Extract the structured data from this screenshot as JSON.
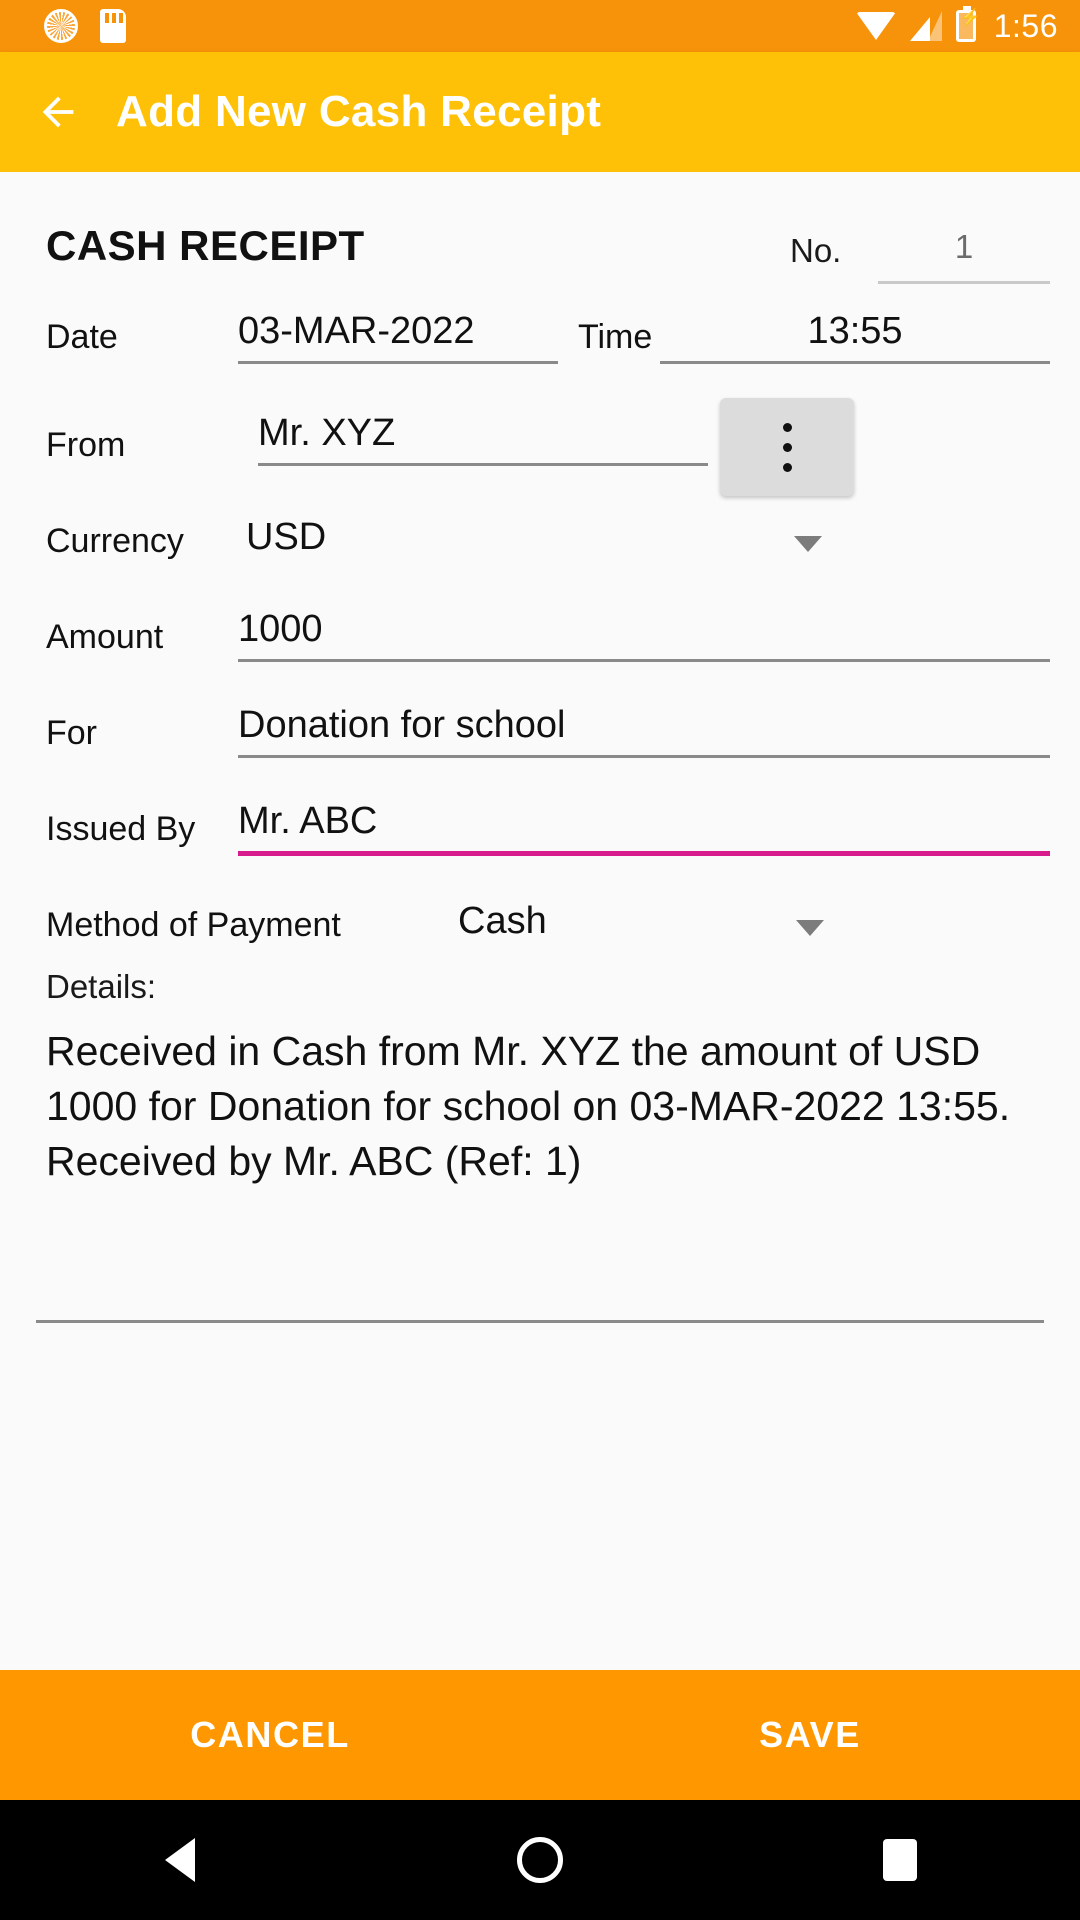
{
  "statusbar": {
    "clock": "1:56",
    "icons": [
      "brightness-icon",
      "sd-card-icon",
      "wifi-icon",
      "signal-icon",
      "battery-charging-icon"
    ]
  },
  "toolbar": {
    "back_label": "back-arrow",
    "title": "Add New Cash Receipt",
    "background": "#FFC107"
  },
  "form": {
    "section_title": "CASH RECEIPT",
    "no_label": "No.",
    "no_value": "1",
    "date_label": "Date",
    "date_value": "03-MAR-2022",
    "time_label": "Time",
    "time_value": "13:55",
    "from_label": "From",
    "from_value": "Mr. XYZ",
    "more_button_label": "⋮",
    "currency_label": "Currency",
    "currency_value": "USD",
    "amount_label": "Amount",
    "amount_value": "1000",
    "for_label": "For",
    "for_value": "Donation for school",
    "issued_by_label": "Issued By",
    "issued_by_value": "Mr. ABC",
    "issued_by_focus_color": "#D81B8C",
    "method_label": "Method of Payment",
    "method_value": "Cash",
    "details_label": "Details:",
    "details_text": "Received in Cash from Mr. XYZ the amount of USD 1000 for Donation for school on 03-MAR-2022 13:55. Received by Mr. ABC (Ref: 1)"
  },
  "actions": {
    "cancel_label": "CANCEL",
    "save_label": "SAVE",
    "background": "#FF9800"
  },
  "navbar": {
    "back": "nav-back-icon",
    "home": "nav-home-icon",
    "recents": "nav-recents-icon"
  }
}
